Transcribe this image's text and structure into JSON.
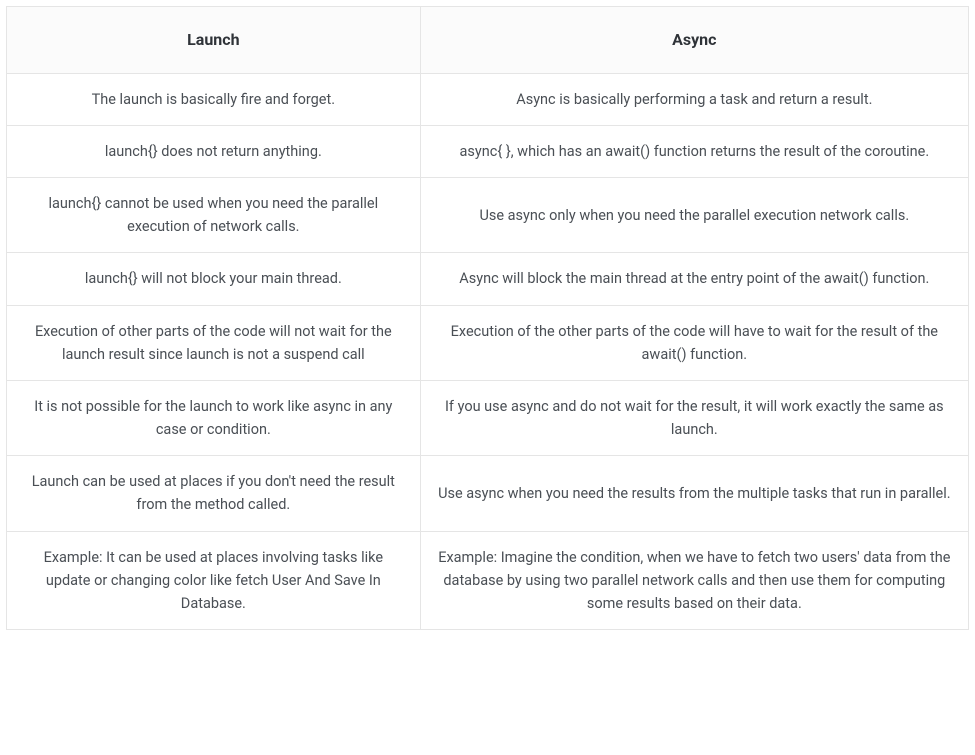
{
  "table": {
    "headers": {
      "launch": "Launch",
      "async": "Async"
    },
    "rows": [
      {
        "launch": "The launch is basically fire and forget.",
        "async": "Async is basically performing a task and return a result."
      },
      {
        "launch": "launch{} does not return anything.",
        "async": "async{ }, which has an await() function returns the result of the coroutine."
      },
      {
        "launch": "launch{} cannot be used when you need the parallel execution of network calls.",
        "async": "Use async only when you need the parallel execution network calls."
      },
      {
        "launch": "launch{} will not block your main thread.",
        "async": "Async will block the main thread at the entry point of the await() function."
      },
      {
        "launch": "Execution of other parts  of the code will not wait for the launch result since launch is not a suspend call",
        "async": "Execution of the other parts of the code will have to wait for the result of the await() function."
      },
      {
        "launch": "It is not possible for the launch to work like async in any case or condition.",
        "async": "If you use async and do not wait for the result, it will work exactly the same as launch."
      },
      {
        "launch": "Launch can be used at places if you don't need the result from the method called.",
        "async": "Use async when you need the results from the multiple tasks that run in parallel."
      },
      {
        "launch": "Example: It can be used at places involving tasks like update or changing color like fetch User And Save In Database.",
        "async": "Example: Imagine the condition, when we have to fetch two users' data from the database by using two parallel network calls and then use them for computing some results based on their data."
      }
    ]
  }
}
